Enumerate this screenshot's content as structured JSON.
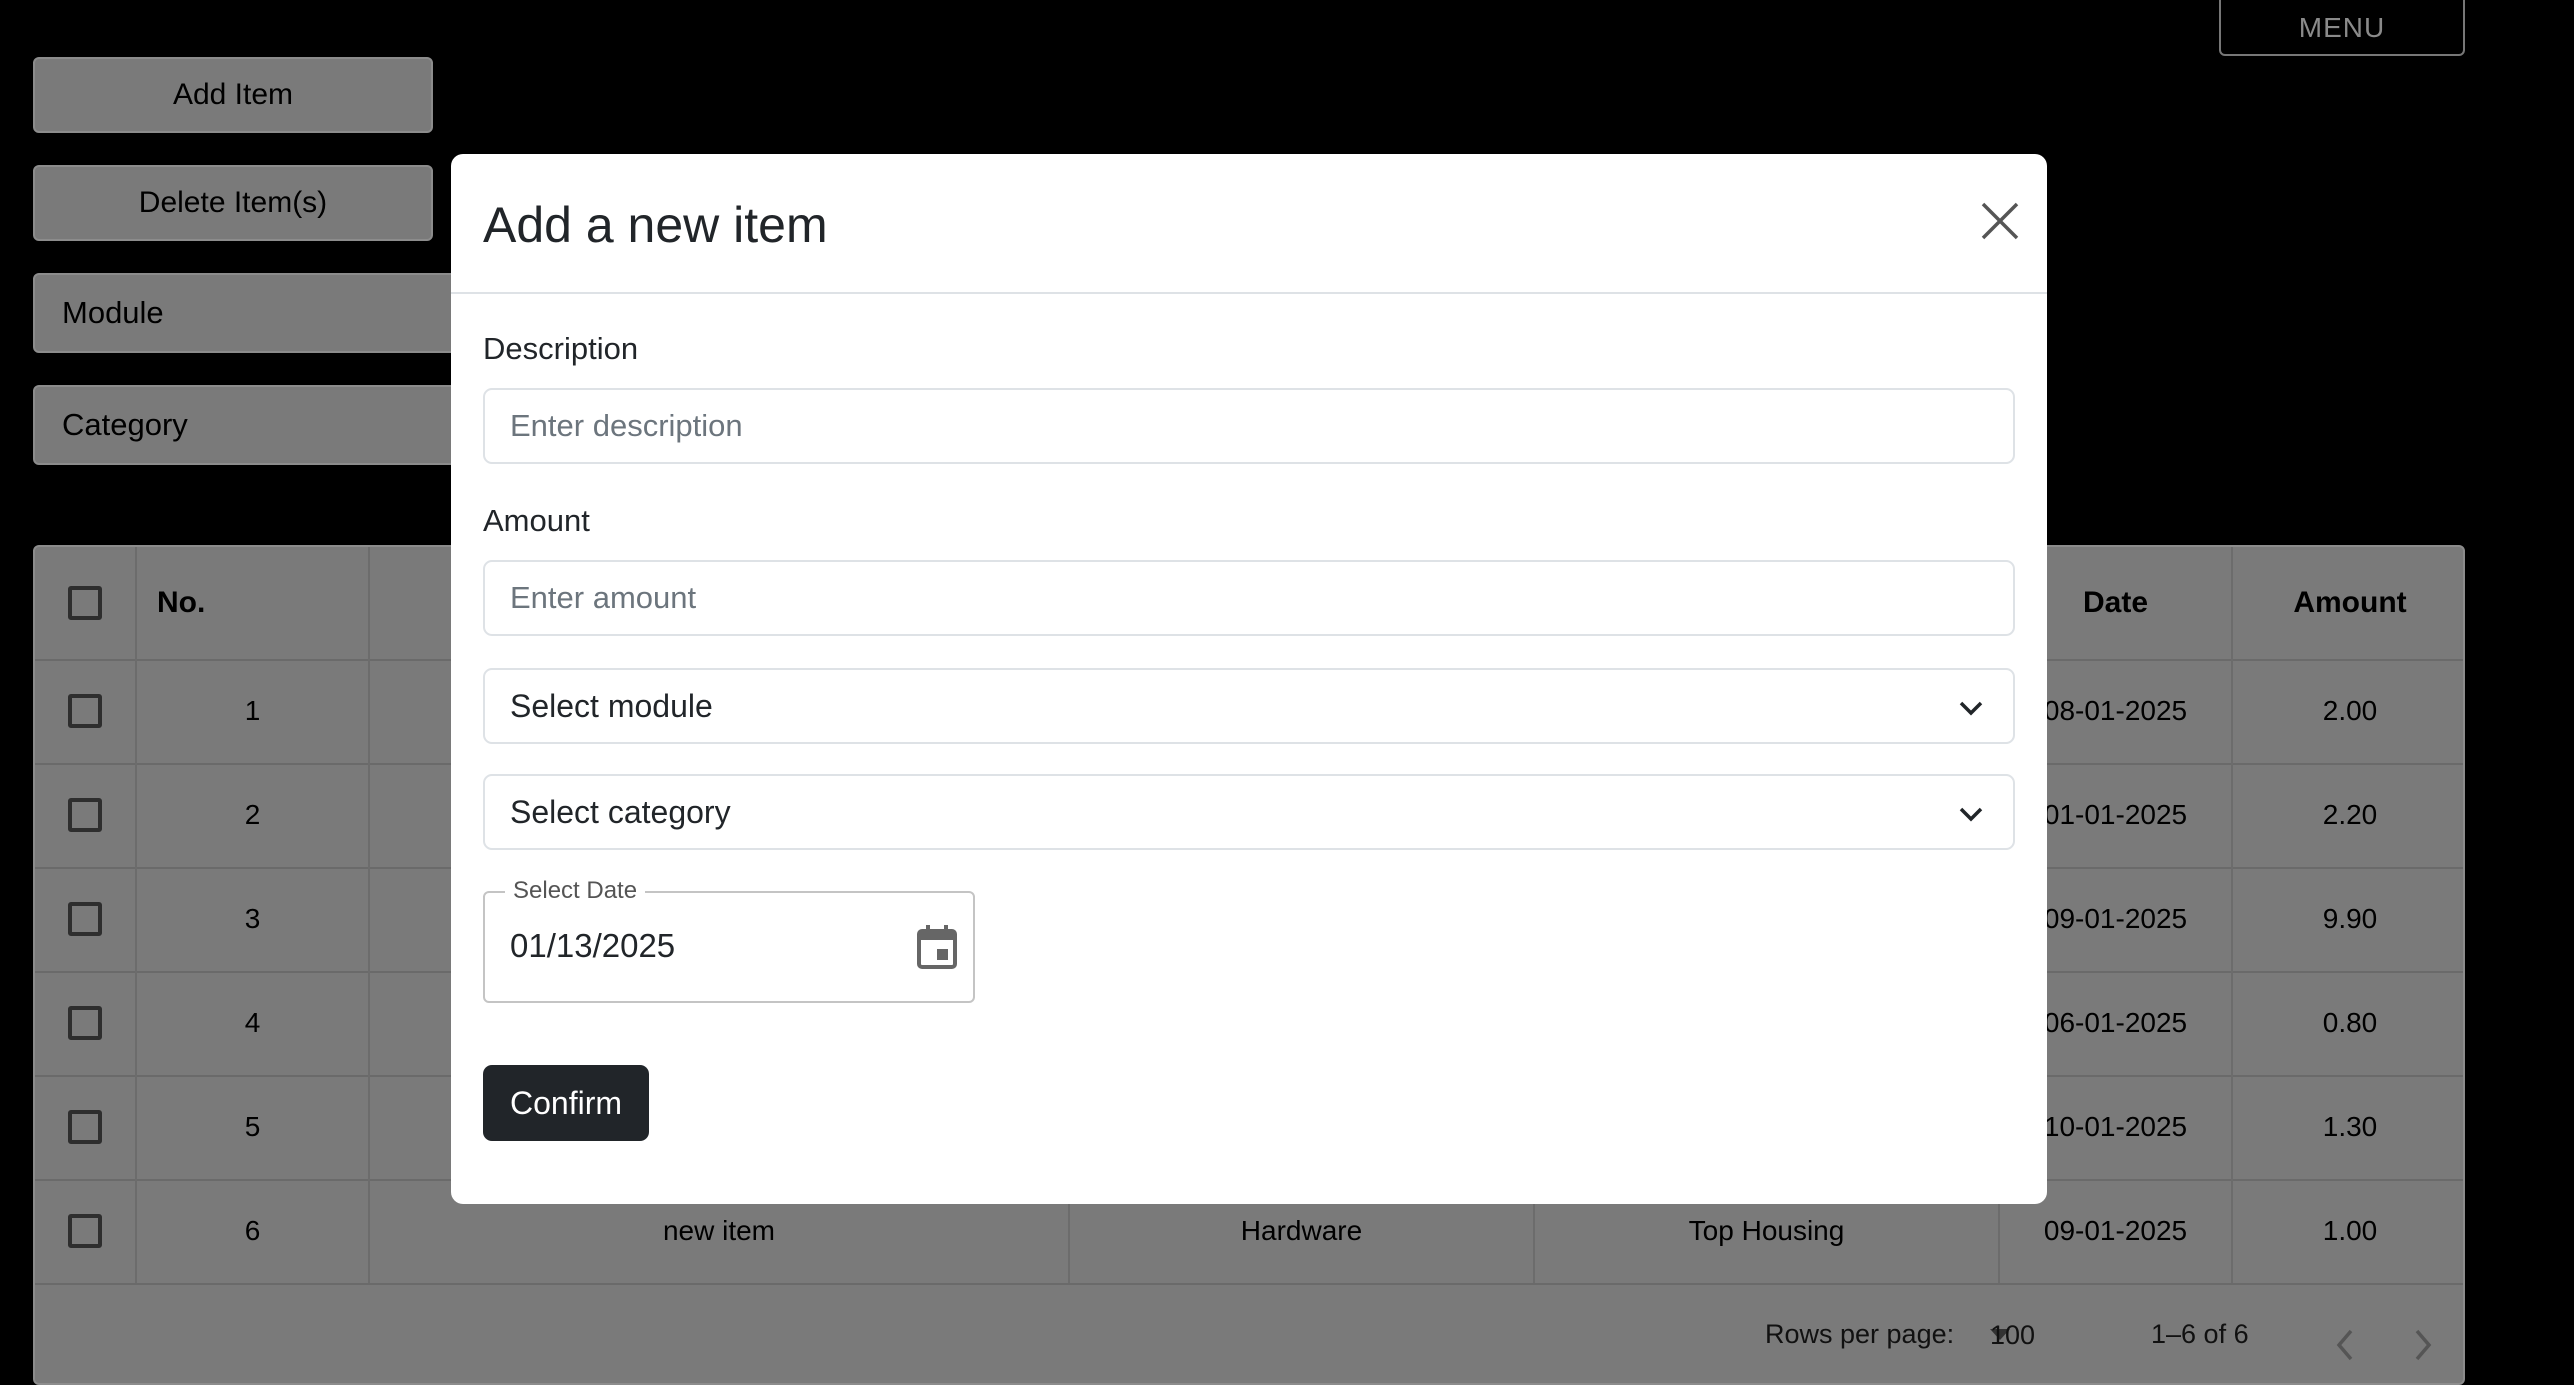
{
  "top_bar": {
    "menu_label": "MENU"
  },
  "sidebar": {
    "add_label": "Add Item",
    "delete_label": "Delete Item(s)",
    "module_label": "Module",
    "category_label": "Category"
  },
  "grid": {
    "headers": {
      "no": "No.",
      "date": "Date",
      "amount": "Amount"
    },
    "rows": [
      {
        "no": "1",
        "date": "08-01-2025",
        "amount": "2.00"
      },
      {
        "no": "2",
        "date": "01-01-2025",
        "amount": "2.20"
      },
      {
        "no": "3",
        "date": "09-01-2025",
        "amount": "9.90"
      },
      {
        "no": "4",
        "date": "06-01-2025",
        "amount": "0.80"
      },
      {
        "no": "5",
        "date": "10-01-2025",
        "amount": "1.30"
      },
      {
        "no": "6",
        "description": "new item",
        "module": "Hardware",
        "category": "Top Housing",
        "date": "09-01-2025",
        "amount": "1.00"
      }
    ],
    "footer": {
      "rows_per_page_label": "Rows per page:",
      "rows_per_page_value": "100",
      "range": "1–6 of 6"
    }
  },
  "modal": {
    "title": "Add a new item",
    "description_label": "Description",
    "description_placeholder": "Enter description",
    "amount_label": "Amount",
    "amount_placeholder": "Enter amount",
    "module_select": "Select module",
    "category_select": "Select category",
    "date_label": "Select Date",
    "date_value": "01/13/2025",
    "confirm_label": "Confirm"
  },
  "colors": {
    "overlay_bg": "#000000",
    "dimmed_surface": "#7a7a7a",
    "modal_bg": "#ffffff",
    "confirm_bg": "#212529"
  }
}
